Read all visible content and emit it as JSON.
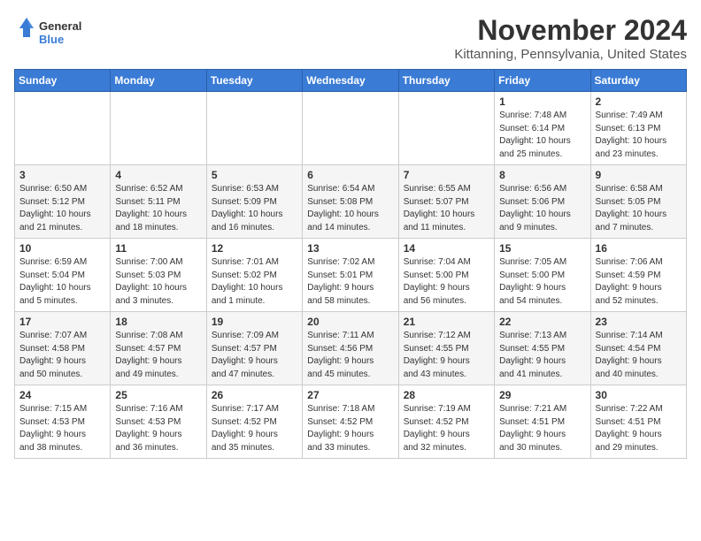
{
  "header": {
    "logo_general": "General",
    "logo_blue": "Blue",
    "month_title": "November 2024",
    "location": "Kittanning, Pennsylvania, United States"
  },
  "days_of_week": [
    "Sunday",
    "Monday",
    "Tuesday",
    "Wednesday",
    "Thursday",
    "Friday",
    "Saturday"
  ],
  "weeks": [
    [
      {
        "day": "",
        "info": ""
      },
      {
        "day": "",
        "info": ""
      },
      {
        "day": "",
        "info": ""
      },
      {
        "day": "",
        "info": ""
      },
      {
        "day": "",
        "info": ""
      },
      {
        "day": "1",
        "info": "Sunrise: 7:48 AM\nSunset: 6:14 PM\nDaylight: 10 hours\nand 25 minutes."
      },
      {
        "day": "2",
        "info": "Sunrise: 7:49 AM\nSunset: 6:13 PM\nDaylight: 10 hours\nand 23 minutes."
      }
    ],
    [
      {
        "day": "3",
        "info": "Sunrise: 6:50 AM\nSunset: 5:12 PM\nDaylight: 10 hours\nand 21 minutes."
      },
      {
        "day": "4",
        "info": "Sunrise: 6:52 AM\nSunset: 5:11 PM\nDaylight: 10 hours\nand 18 minutes."
      },
      {
        "day": "5",
        "info": "Sunrise: 6:53 AM\nSunset: 5:09 PM\nDaylight: 10 hours\nand 16 minutes."
      },
      {
        "day": "6",
        "info": "Sunrise: 6:54 AM\nSunset: 5:08 PM\nDaylight: 10 hours\nand 14 minutes."
      },
      {
        "day": "7",
        "info": "Sunrise: 6:55 AM\nSunset: 5:07 PM\nDaylight: 10 hours\nand 11 minutes."
      },
      {
        "day": "8",
        "info": "Sunrise: 6:56 AM\nSunset: 5:06 PM\nDaylight: 10 hours\nand 9 minutes."
      },
      {
        "day": "9",
        "info": "Sunrise: 6:58 AM\nSunset: 5:05 PM\nDaylight: 10 hours\nand 7 minutes."
      }
    ],
    [
      {
        "day": "10",
        "info": "Sunrise: 6:59 AM\nSunset: 5:04 PM\nDaylight: 10 hours\nand 5 minutes."
      },
      {
        "day": "11",
        "info": "Sunrise: 7:00 AM\nSunset: 5:03 PM\nDaylight: 10 hours\nand 3 minutes."
      },
      {
        "day": "12",
        "info": "Sunrise: 7:01 AM\nSunset: 5:02 PM\nDaylight: 10 hours\nand 1 minute."
      },
      {
        "day": "13",
        "info": "Sunrise: 7:02 AM\nSunset: 5:01 PM\nDaylight: 9 hours\nand 58 minutes."
      },
      {
        "day": "14",
        "info": "Sunrise: 7:04 AM\nSunset: 5:00 PM\nDaylight: 9 hours\nand 56 minutes."
      },
      {
        "day": "15",
        "info": "Sunrise: 7:05 AM\nSunset: 5:00 PM\nDaylight: 9 hours\nand 54 minutes."
      },
      {
        "day": "16",
        "info": "Sunrise: 7:06 AM\nSunset: 4:59 PM\nDaylight: 9 hours\nand 52 minutes."
      }
    ],
    [
      {
        "day": "17",
        "info": "Sunrise: 7:07 AM\nSunset: 4:58 PM\nDaylight: 9 hours\nand 50 minutes."
      },
      {
        "day": "18",
        "info": "Sunrise: 7:08 AM\nSunset: 4:57 PM\nDaylight: 9 hours\nand 49 minutes."
      },
      {
        "day": "19",
        "info": "Sunrise: 7:09 AM\nSunset: 4:57 PM\nDaylight: 9 hours\nand 47 minutes."
      },
      {
        "day": "20",
        "info": "Sunrise: 7:11 AM\nSunset: 4:56 PM\nDaylight: 9 hours\nand 45 minutes."
      },
      {
        "day": "21",
        "info": "Sunrise: 7:12 AM\nSunset: 4:55 PM\nDaylight: 9 hours\nand 43 minutes."
      },
      {
        "day": "22",
        "info": "Sunrise: 7:13 AM\nSunset: 4:55 PM\nDaylight: 9 hours\nand 41 minutes."
      },
      {
        "day": "23",
        "info": "Sunrise: 7:14 AM\nSunset: 4:54 PM\nDaylight: 9 hours\nand 40 minutes."
      }
    ],
    [
      {
        "day": "24",
        "info": "Sunrise: 7:15 AM\nSunset: 4:53 PM\nDaylight: 9 hours\nand 38 minutes."
      },
      {
        "day": "25",
        "info": "Sunrise: 7:16 AM\nSunset: 4:53 PM\nDaylight: 9 hours\nand 36 minutes."
      },
      {
        "day": "26",
        "info": "Sunrise: 7:17 AM\nSunset: 4:52 PM\nDaylight: 9 hours\nand 35 minutes."
      },
      {
        "day": "27",
        "info": "Sunrise: 7:18 AM\nSunset: 4:52 PM\nDaylight: 9 hours\nand 33 minutes."
      },
      {
        "day": "28",
        "info": "Sunrise: 7:19 AM\nSunset: 4:52 PM\nDaylight: 9 hours\nand 32 minutes."
      },
      {
        "day": "29",
        "info": "Sunrise: 7:21 AM\nSunset: 4:51 PM\nDaylight: 9 hours\nand 30 minutes."
      },
      {
        "day": "30",
        "info": "Sunrise: 7:22 AM\nSunset: 4:51 PM\nDaylight: 9 hours\nand 29 minutes."
      }
    ]
  ]
}
